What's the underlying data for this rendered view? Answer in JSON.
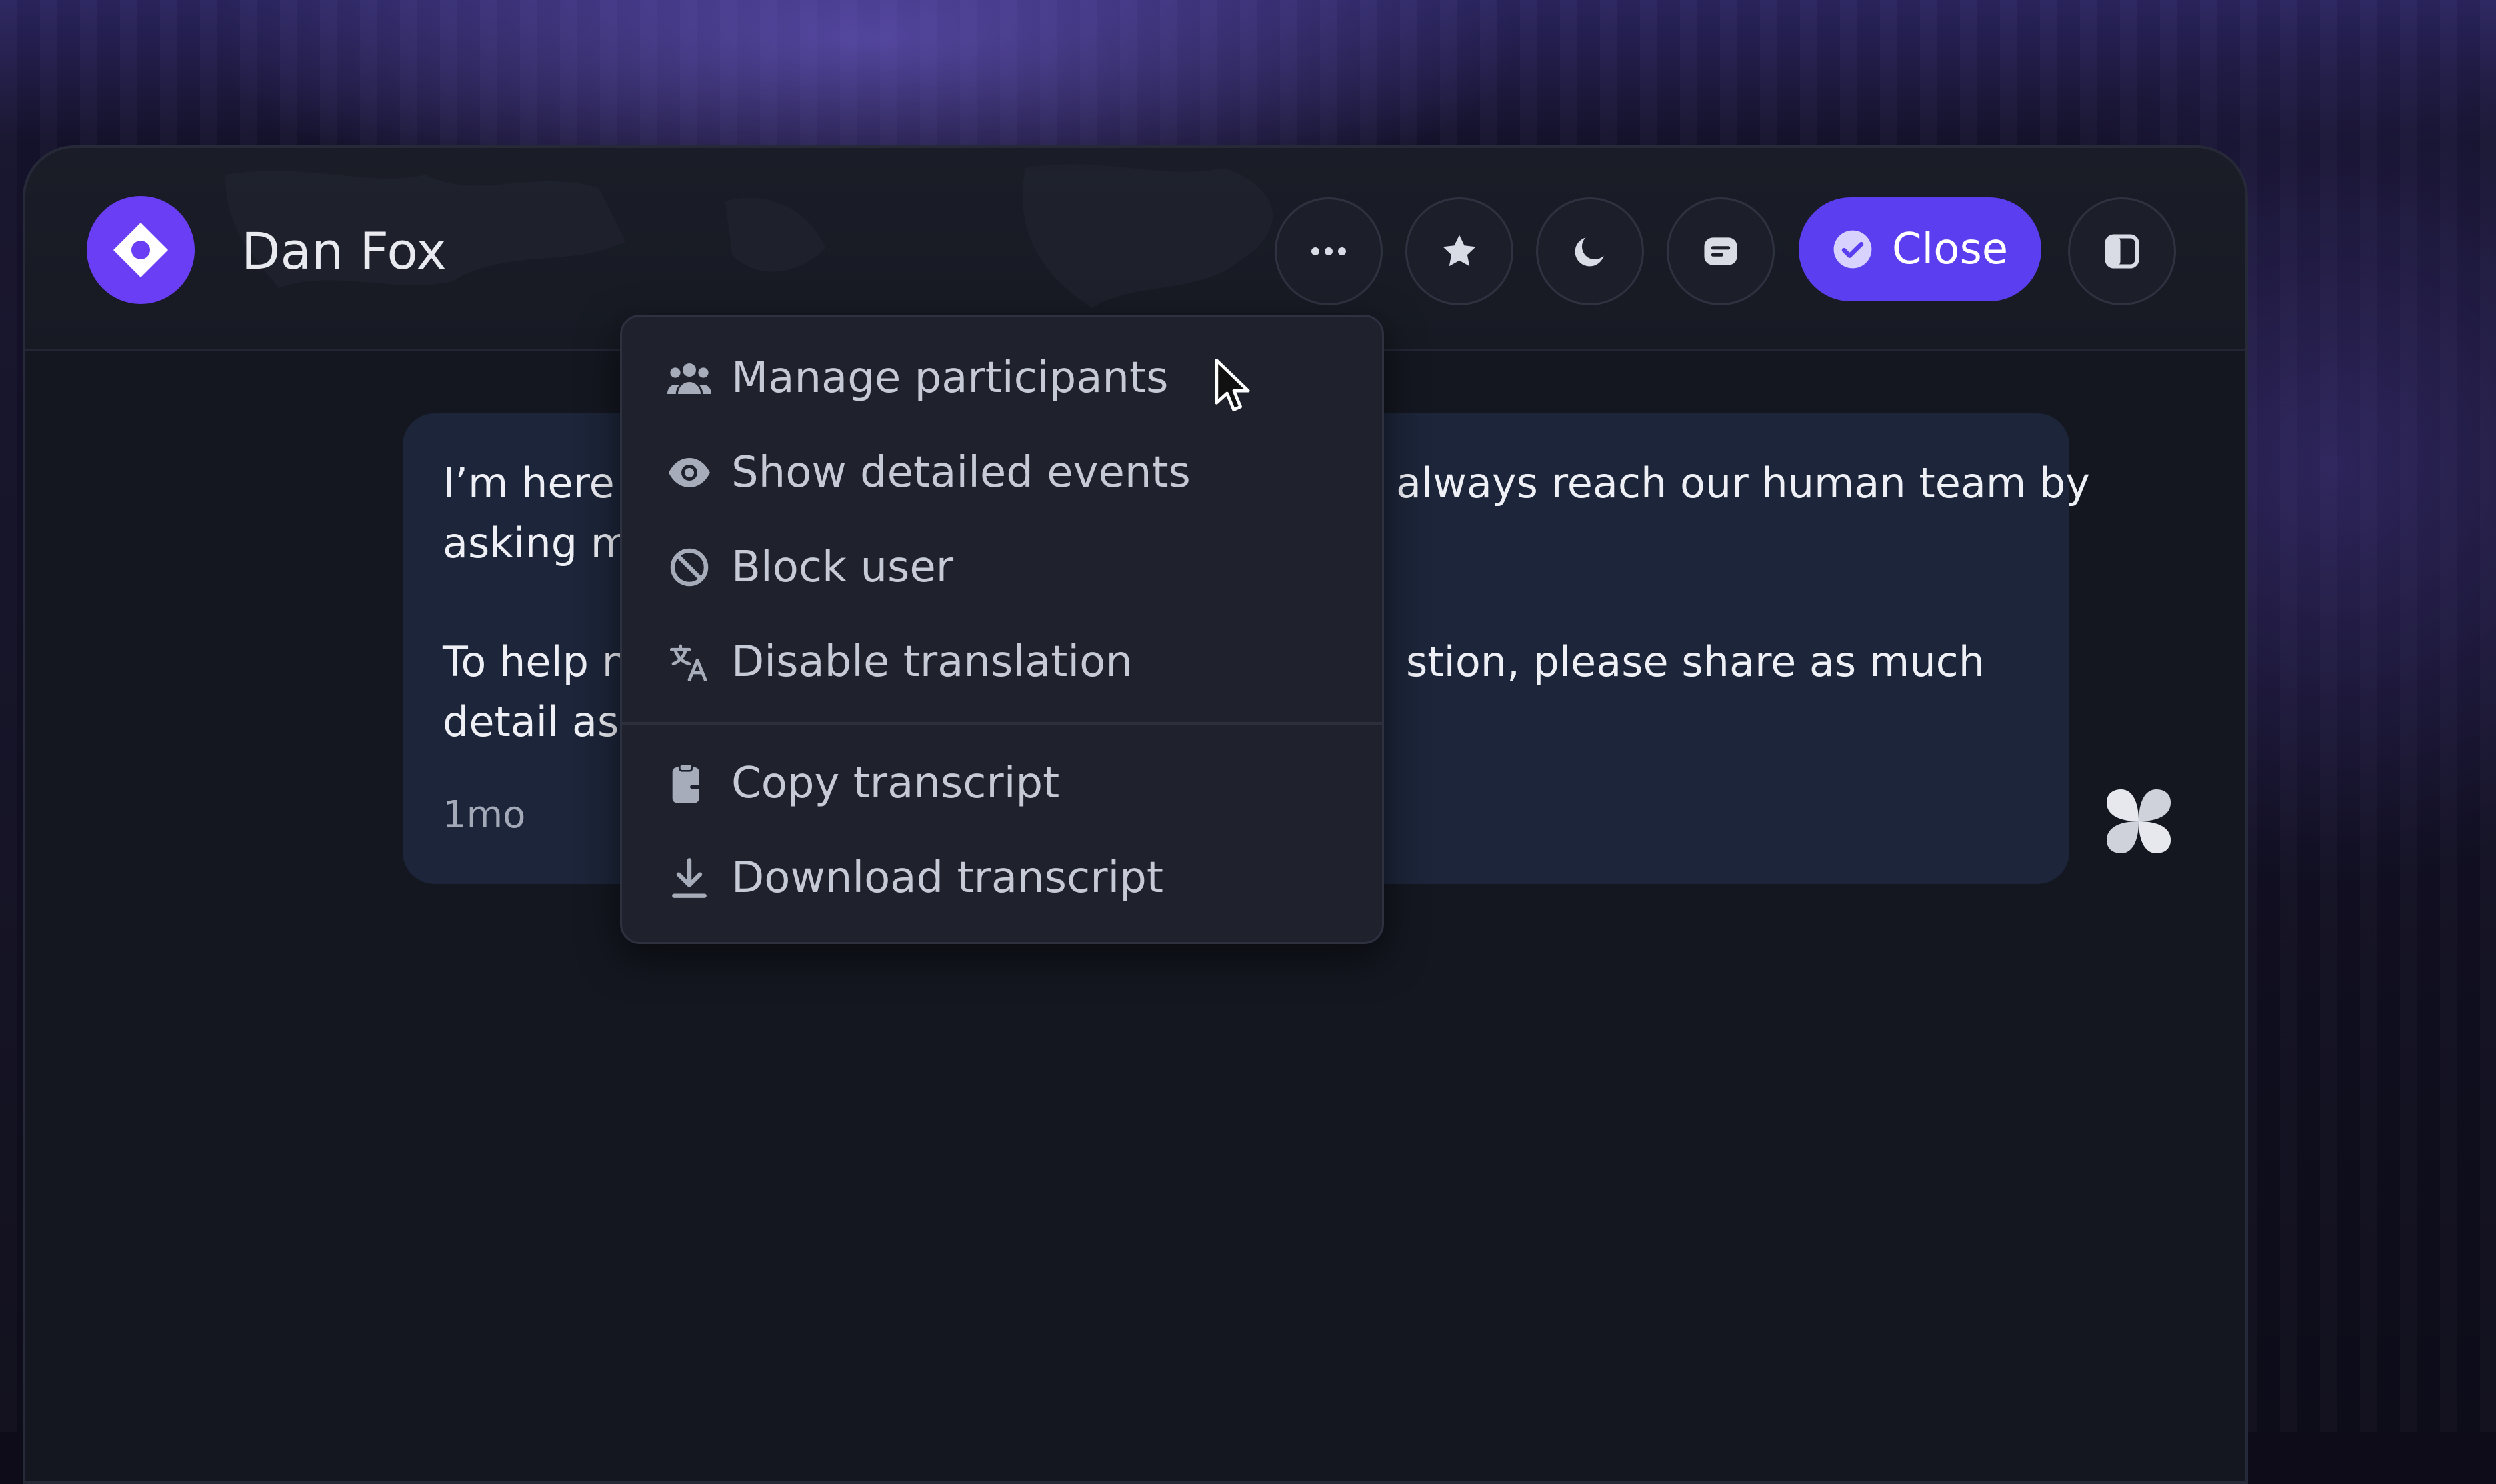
{
  "header": {
    "title": "Dan Fox",
    "close_label": "Close"
  },
  "message": {
    "line1_left": "I’m here t",
    "line1_right": "always reach our human team by",
    "line2_left": "asking m",
    "line3_left": "To help n",
    "line3_right": "stion, please share as much",
    "line4_left": "detail as",
    "time": "1mo"
  },
  "menu": {
    "items": [
      {
        "label": "Manage participants",
        "icon": "participants-icon"
      },
      {
        "label": "Show detailed events",
        "icon": "eye-icon"
      },
      {
        "label": "Block user",
        "icon": "block-icon"
      },
      {
        "label": "Disable translation",
        "icon": "translate-icon"
      },
      {
        "label": "Copy transcript",
        "icon": "clipboard-icon"
      },
      {
        "label": "Download transcript",
        "icon": "download-icon"
      }
    ]
  },
  "colors": {
    "accent": "#5a3ef0",
    "brand": "#6a3ef5",
    "panel": "#141720",
    "bubble": "#1c2539",
    "menu": "#1f222c"
  }
}
